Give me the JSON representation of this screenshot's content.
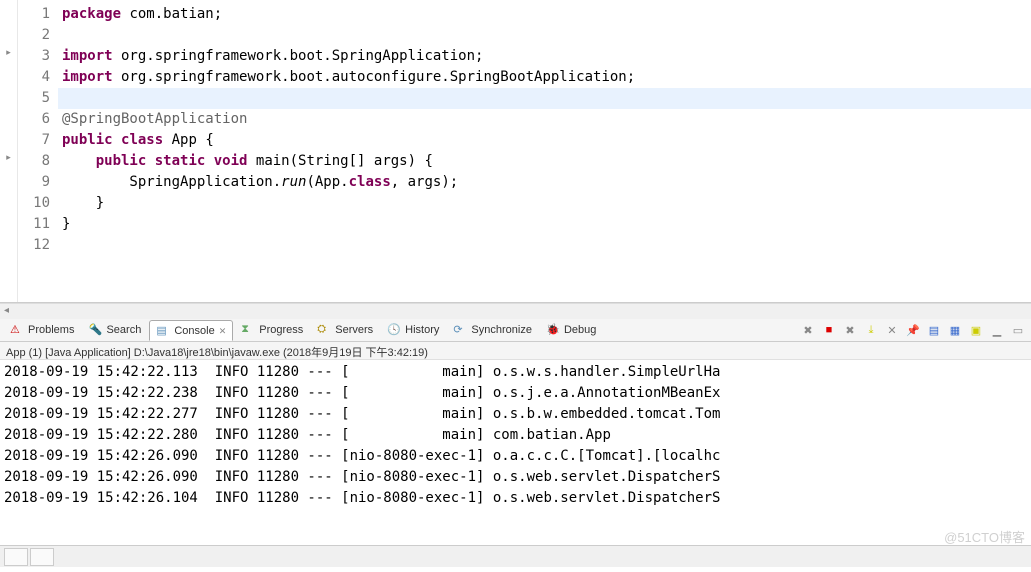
{
  "code": {
    "lines": [
      {
        "n": 1,
        "marker": "",
        "segs": [
          [
            "kw",
            "package"
          ],
          [
            "",
            " com.batian;"
          ]
        ]
      },
      {
        "n": 2,
        "marker": "",
        "segs": []
      },
      {
        "n": 3,
        "marker": "arrow",
        "segs": [
          [
            "kw",
            "import"
          ],
          [
            "",
            " org.springframework.boot.SpringApplication;"
          ]
        ]
      },
      {
        "n": 4,
        "marker": "",
        "segs": [
          [
            "kw",
            "import"
          ],
          [
            "",
            " org.springframework.boot.autoconfigure.SpringBootApplication;"
          ]
        ]
      },
      {
        "n": 5,
        "marker": "",
        "hl": true,
        "segs": []
      },
      {
        "n": 6,
        "marker": "",
        "segs": [
          [
            "ann",
            "@SpringBootApplication"
          ]
        ]
      },
      {
        "n": 7,
        "marker": "",
        "segs": [
          [
            "kw",
            "public"
          ],
          [
            "",
            " "
          ],
          [
            "kw",
            "class"
          ],
          [
            "",
            " App {"
          ]
        ]
      },
      {
        "n": 8,
        "marker": "arrow",
        "segs": [
          [
            "",
            "    "
          ],
          [
            "kw",
            "public"
          ],
          [
            "",
            " "
          ],
          [
            "kw",
            "static"
          ],
          [
            "",
            " "
          ],
          [
            "kw",
            "void"
          ],
          [
            "",
            " main(String[] args) {"
          ]
        ]
      },
      {
        "n": 9,
        "marker": "",
        "segs": [
          [
            "",
            "        SpringApplication."
          ],
          [
            "static-call",
            "run"
          ],
          [
            "",
            "(App."
          ],
          [
            "cls-ref",
            "class"
          ],
          [
            "",
            ", args);"
          ]
        ]
      },
      {
        "n": 10,
        "marker": "",
        "segs": [
          [
            "",
            "    }"
          ]
        ]
      },
      {
        "n": 11,
        "marker": "",
        "segs": [
          [
            "",
            "}"
          ]
        ]
      },
      {
        "n": 12,
        "marker": "",
        "segs": []
      }
    ]
  },
  "views": {
    "tabs": [
      {
        "label": "Problems",
        "icon": "ic-problems",
        "glyph": "⚠"
      },
      {
        "label": "Search",
        "icon": "ic-search",
        "glyph": "🔦"
      },
      {
        "label": "Console",
        "icon": "ic-console",
        "glyph": "▤",
        "active": true,
        "closable": true
      },
      {
        "label": "Progress",
        "icon": "ic-progress",
        "glyph": "⧗"
      },
      {
        "label": "Servers",
        "icon": "ic-servers",
        "glyph": "⛭"
      },
      {
        "label": "History",
        "icon": "ic-history",
        "glyph": "🕓"
      },
      {
        "label": "Synchronize",
        "icon": "ic-sync",
        "glyph": "⟳"
      },
      {
        "label": "Debug",
        "icon": "ic-debug",
        "glyph": "🐞"
      }
    ],
    "toolbar": [
      {
        "name": "remove-launch-icon",
        "cls": "gray",
        "glyph": "✖"
      },
      {
        "name": "terminate-icon",
        "cls": "red-sq",
        "glyph": "■"
      },
      {
        "name": "remove-all-icon",
        "cls": "gray",
        "glyph": "✖"
      },
      {
        "name": "scroll-lock-icon",
        "cls": "yellow",
        "glyph": "⤓"
      },
      {
        "name": "clear-console-icon",
        "cls": "gray",
        "glyph": "✕"
      },
      {
        "name": "pin-console-icon",
        "cls": "gray",
        "glyph": "📌"
      },
      {
        "name": "display-selected-icon",
        "cls": "blue",
        "glyph": "▤"
      },
      {
        "name": "show-console-icon",
        "cls": "blue",
        "glyph": "▦"
      },
      {
        "name": "open-console-icon",
        "cls": "yellow",
        "glyph": "▣"
      },
      {
        "name": "minimize-icon",
        "cls": "gray",
        "glyph": "▁"
      },
      {
        "name": "maximize-icon",
        "cls": "gray",
        "glyph": "▭"
      }
    ]
  },
  "console": {
    "header": "App (1) [Java Application] D:\\Java18\\jre18\\bin\\javaw.exe (2018年9月19日 下午3:42:19)",
    "lines": [
      "2018-09-19 15:42:22.113  INFO 11280 --- [           main] o.s.w.s.handler.SimpleUrlHa",
      "2018-09-19 15:42:22.238  INFO 11280 --- [           main] o.s.j.e.a.AnnotationMBeanEx",
      "2018-09-19 15:42:22.277  INFO 11280 --- [           main] o.s.b.w.embedded.tomcat.Tom",
      "2018-09-19 15:42:22.280  INFO 11280 --- [           main] com.batian.App",
      "2018-09-19 15:42:26.090  INFO 11280 --- [nio-8080-exec-1] o.a.c.c.C.[Tomcat].[localhc",
      "2018-09-19 15:42:26.090  INFO 11280 --- [nio-8080-exec-1] o.s.web.servlet.DispatcherS",
      "2018-09-19 15:42:26.104  INFO 11280 --- [nio-8080-exec-1] o.s.web.servlet.DispatcherS"
    ]
  },
  "watermark": "@51CTO博客"
}
